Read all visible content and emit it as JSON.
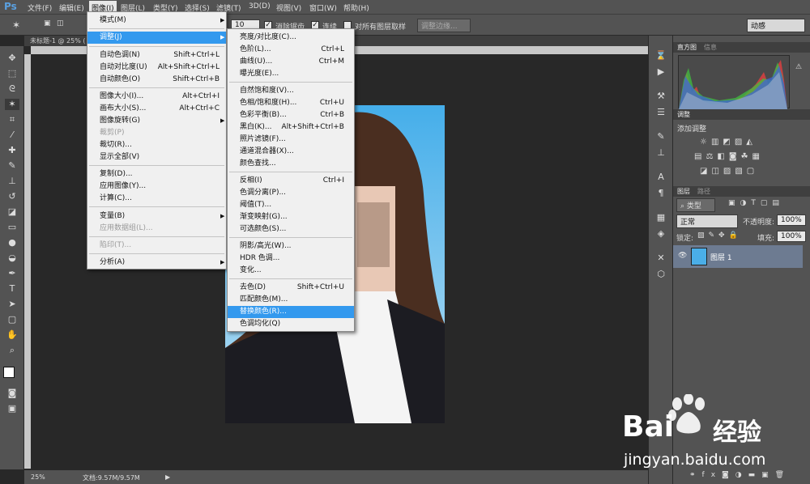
{
  "app": {
    "logo": "Ps"
  },
  "menubar": [
    {
      "label": "文件(F)"
    },
    {
      "label": "编辑(E)"
    },
    {
      "label": "图像(I)"
    },
    {
      "label": "图层(L)"
    },
    {
      "label": "类型(Y)"
    },
    {
      "label": "选择(S)"
    },
    {
      "label": "滤镜(T)"
    },
    {
      "label": "3D(D)"
    },
    {
      "label": "视图(V)"
    },
    {
      "label": "窗口(W)"
    },
    {
      "label": "帮助(H)"
    }
  ],
  "options": {
    "tolerance_value": "10",
    "antialias_label": "消除锯齿",
    "contiguous_label": "连续",
    "sample_all_label": "对所有图层取样",
    "refine_edge_label": "调整边缘...",
    "workspace": "动感"
  },
  "document": {
    "tab_title": "未标题-1 @ 25% (",
    "zoom": "25%",
    "doc_size": "文档:9.57M/9.57M"
  },
  "image_menu": {
    "items": [
      {
        "label": "模式(M)",
        "shortcut": "",
        "submenu": true
      },
      {
        "label": "调整(J)",
        "shortcut": "",
        "submenu": true,
        "highlight": true
      },
      {
        "label": "自动色调(N)",
        "shortcut": "Shift+Ctrl+L"
      },
      {
        "label": "自动对比度(U)",
        "shortcut": "Alt+Shift+Ctrl+L"
      },
      {
        "label": "自动颜色(O)",
        "shortcut": "Shift+Ctrl+B"
      },
      {
        "label": "图像大小(I)...",
        "shortcut": "Alt+Ctrl+I"
      },
      {
        "label": "画布大小(S)...",
        "shortcut": "Alt+Ctrl+C"
      },
      {
        "label": "图像旋转(G)",
        "shortcut": "",
        "submenu": true
      },
      {
        "label": "裁剪(P)",
        "shortcut": "",
        "disabled": true
      },
      {
        "label": "裁切(R)...",
        "shortcut": ""
      },
      {
        "label": "显示全部(V)",
        "shortcut": ""
      },
      {
        "label": "复制(D)...",
        "shortcut": ""
      },
      {
        "label": "应用图像(Y)...",
        "shortcut": ""
      },
      {
        "label": "计算(C)...",
        "shortcut": ""
      },
      {
        "label": "变量(B)",
        "shortcut": "",
        "submenu": true
      },
      {
        "label": "应用数据组(L)...",
        "shortcut": "",
        "disabled": true
      },
      {
        "label": "陷印(T)...",
        "shortcut": "",
        "disabled": true
      },
      {
        "label": "分析(A)",
        "shortcut": "",
        "submenu": true
      }
    ]
  },
  "adjust_menu": {
    "items": [
      {
        "label": "亮度/对比度(C)...",
        "shortcut": ""
      },
      {
        "label": "色阶(L)...",
        "shortcut": "Ctrl+L"
      },
      {
        "label": "曲线(U)...",
        "shortcut": "Ctrl+M"
      },
      {
        "label": "曝光度(E)...",
        "shortcut": ""
      },
      {
        "label": "自然饱和度(V)...",
        "shortcut": ""
      },
      {
        "label": "色相/饱和度(H)...",
        "shortcut": "Ctrl+U"
      },
      {
        "label": "色彩平衡(B)...",
        "shortcut": "Ctrl+B"
      },
      {
        "label": "黑白(K)...",
        "shortcut": "Alt+Shift+Ctrl+B"
      },
      {
        "label": "照片滤镜(F)...",
        "shortcut": ""
      },
      {
        "label": "通道混合器(X)...",
        "shortcut": ""
      },
      {
        "label": "颜色查找...",
        "shortcut": ""
      },
      {
        "label": "反相(I)",
        "shortcut": "Ctrl+I"
      },
      {
        "label": "色调分离(P)...",
        "shortcut": ""
      },
      {
        "label": "阈值(T)...",
        "shortcut": ""
      },
      {
        "label": "渐变映射(G)...",
        "shortcut": ""
      },
      {
        "label": "可选颜色(S)...",
        "shortcut": ""
      },
      {
        "label": "阴影/高光(W)...",
        "shortcut": ""
      },
      {
        "label": "HDR 色调...",
        "shortcut": ""
      },
      {
        "label": "变化...",
        "shortcut": ""
      },
      {
        "label": "去色(D)",
        "shortcut": "Shift+Ctrl+U"
      },
      {
        "label": "匹配颜色(M)...",
        "shortcut": ""
      },
      {
        "label": "替换颜色(R)...",
        "shortcut": "",
        "highlight": true
      },
      {
        "label": "色调均化(Q)",
        "shortcut": ""
      }
    ]
  },
  "panels": {
    "histogram_tab": "直方图",
    "info_tab": "信息",
    "adjustments_tab": "调整",
    "add_adjustment": "添加调整",
    "layers_tab": "图层",
    "paths_tab": "路径",
    "kind_filter": "类型",
    "blend_mode": "正常",
    "opacity_label": "不透明度:",
    "opacity_value": "100%",
    "lock_label": "锁定:",
    "fill_label": "填充:",
    "fill_value": "100%",
    "layer_name": "图层 1"
  },
  "watermark": {
    "brand": "Bai",
    "brand2": "经验",
    "url": "jingyan.baidu.com"
  }
}
